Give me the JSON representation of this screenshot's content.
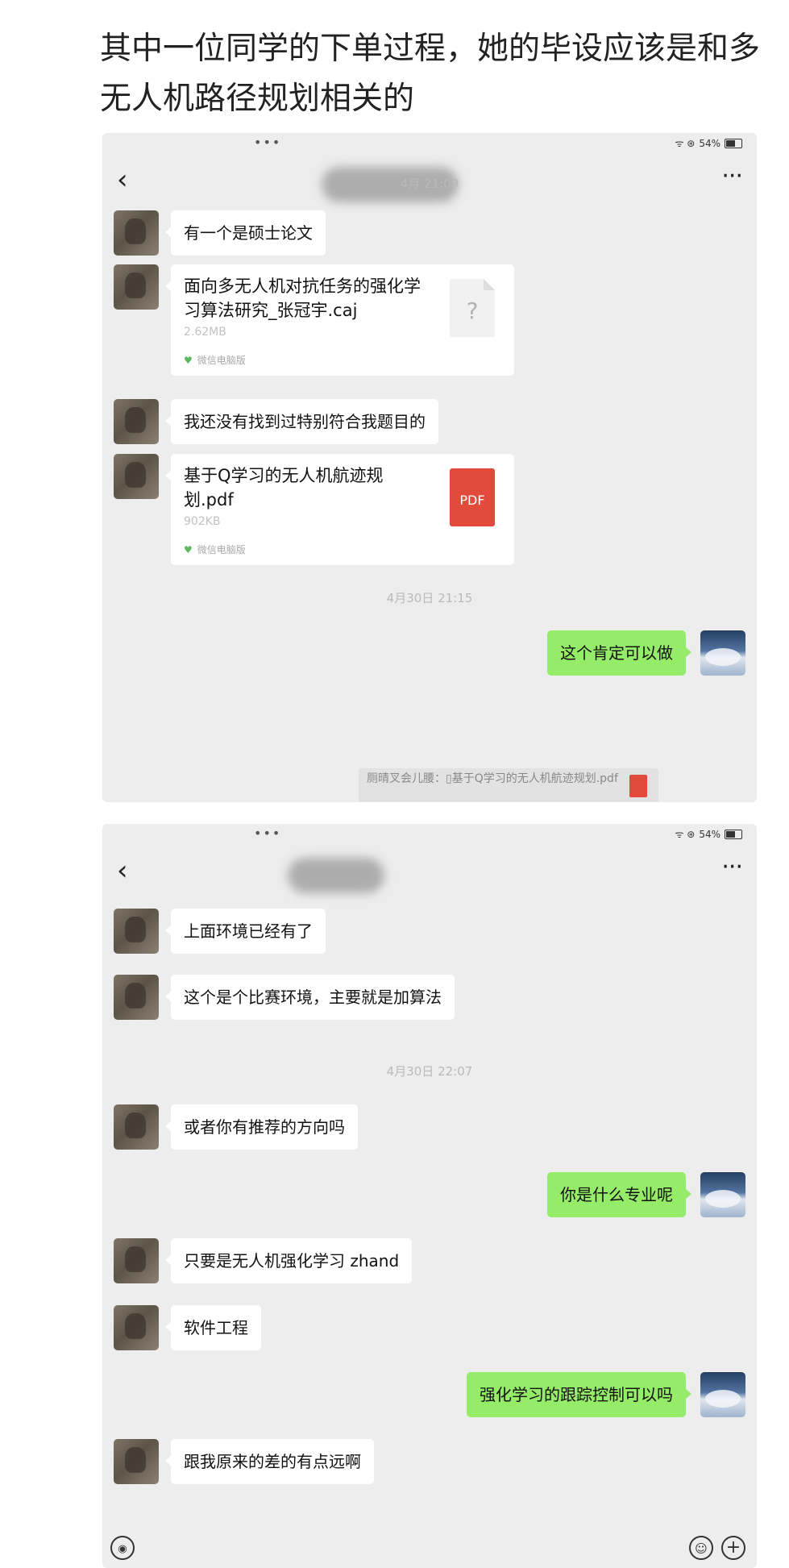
{
  "post": {
    "title": "其中一位同学的下单过程，她的毕设应该是和多无人机路径规划相关的"
  },
  "status_bar": {
    "dots": "•••",
    "signal_icons": "ᯤ ⊛",
    "battery": "54%"
  },
  "nav": {
    "back_glyph": "‹",
    "more_glyph": "···"
  },
  "screenshot1": {
    "timestamp_top": "4月      21:09",
    "messages": [
      {
        "text": "有一个是硕士论文"
      },
      {
        "text": "我还没有找到过特别符合我题目的"
      }
    ],
    "files": [
      {
        "name": "面向多无人机对抗任务的强化学习算法研究_张冠宇.caj",
        "size": "2.62MB",
        "source": "微信电脑版",
        "icon": "unknown-file-icon",
        "icon_glyph": "?"
      },
      {
        "name": "基于Q学习的无人机航迹规划.pdf",
        "size": "902KB",
        "source": "微信电脑版",
        "icon": "pdf-icon",
        "icon_glyph": "PDF"
      }
    ],
    "timestamp_mid": "4月30日 21:15",
    "reply": "这个肯定可以做",
    "quote": "厕晴叉会儿腰：▯基于Q学习的无人机航迹规划.pdf"
  },
  "screenshot2": {
    "messages_top": [
      {
        "text": "上面环境已经有了"
      },
      {
        "text": "这个是个比赛环境，主要就是加算法"
      }
    ],
    "timestamp": "4月30日 22:07",
    "msg_recommend": "或者你有推荐的方向吗",
    "reply_major": "你是什么专业呢",
    "msg_uav": "只要是无人机强化学习 zhand",
    "msg_software": "软件工程",
    "reply_tracking": "强化学习的跟踪控制可以吗",
    "msg_far": "跟我原来的差的有点远啊"
  },
  "bottom_bar": {
    "voice_glyph": "◉",
    "emoji_glyph": "☺",
    "plus_glyph": "+"
  },
  "colors": {
    "chat_background": "#ededed",
    "my_bubble": "#95ec69",
    "their_bubble": "#ffffff",
    "pdf_red": "#e24a3b"
  }
}
